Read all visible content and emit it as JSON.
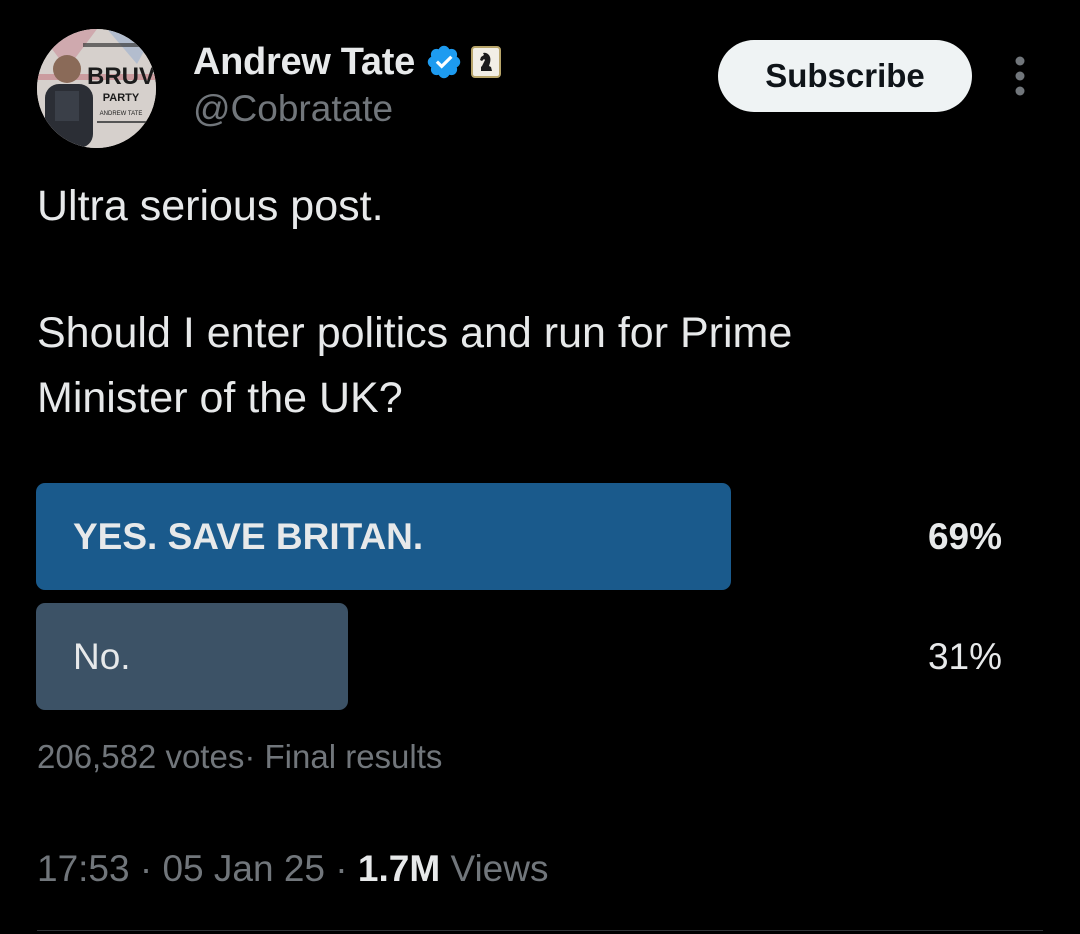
{
  "author": {
    "display_name": "Andrew Tate",
    "handle": "@Cobratate",
    "avatar_text": "BRUV",
    "avatar_subtext": "PARTY",
    "avatar_caption": "ANDREW TATE"
  },
  "header": {
    "subscribe_label": "Subscribe",
    "verified_icon": "verified-badge-icon",
    "affiliate_icon": "chess-knight-affiliate-icon",
    "more_icon": "more-vertical-icon"
  },
  "post": {
    "line1": "Ultra serious post.",
    "line2": "Should I enter politics and run for Prime",
    "line3": "Minister of the UK?"
  },
  "poll": {
    "options": [
      {
        "label": "YES. SAVE BRITAN.",
        "percent_text": "69%",
        "fraction": 0.69,
        "color": "#1a5a8c",
        "winner": true
      },
      {
        "label": "No.",
        "percent_text": "31%",
        "fraction": 0.31,
        "color": "#3c5266",
        "winner": false
      }
    ],
    "votes": "206,582 votes",
    "status": "Final results"
  },
  "meta": {
    "time": "17:53",
    "date": "05 Jan 25",
    "views_count": "1.7M",
    "views_label": "Views"
  },
  "colors": {
    "background": "#000000",
    "text": "#e7e9ea",
    "muted": "#71767b",
    "verified": "#1d9bf0"
  }
}
